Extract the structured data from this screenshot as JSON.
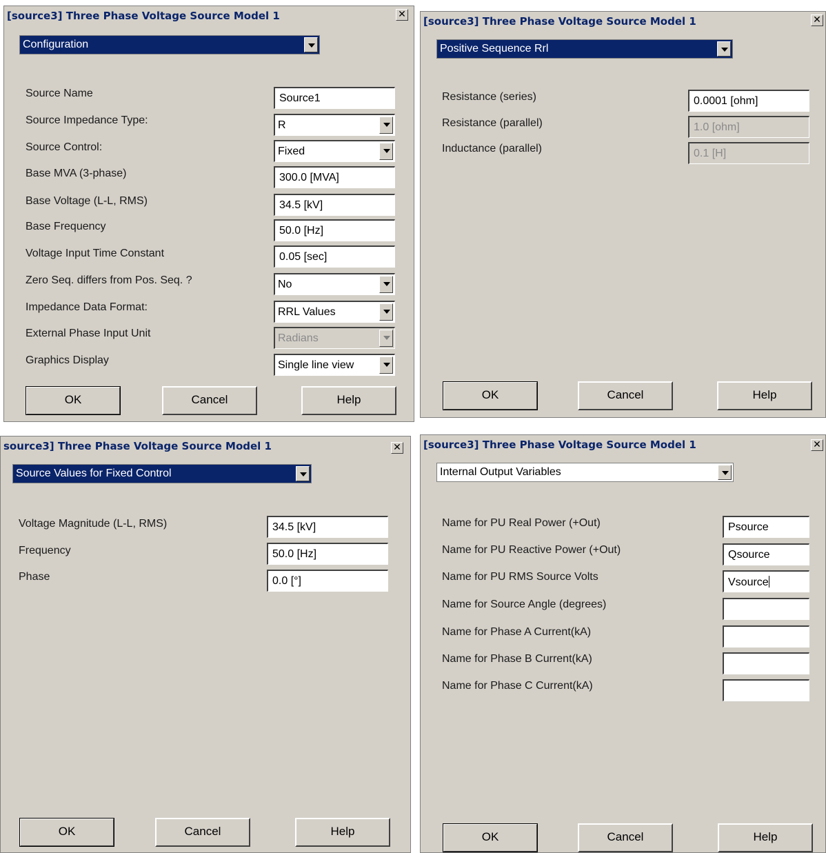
{
  "dialogs": [
    {
      "title": "[source3] Three Phase Voltage Source Model 1",
      "close": "✕",
      "category": "Configuration",
      "fields": [
        {
          "label": "Source Name",
          "value": "Source1",
          "kind": "text"
        },
        {
          "label": "Source Impedance Type:",
          "value": "R",
          "kind": "select"
        },
        {
          "label": "Source Control:",
          "value": "Fixed",
          "kind": "select"
        },
        {
          "label": "Base MVA (3-phase)",
          "value": "300.0 [MVA]",
          "kind": "text"
        },
        {
          "label": "Base Voltage (L-L, RMS)",
          "value": "34.5 [kV]",
          "kind": "text"
        },
        {
          "label": "Base Frequency",
          "value": "50.0 [Hz]",
          "kind": "text"
        },
        {
          "label": "Voltage Input Time Constant",
          "value": "0.05 [sec]",
          "kind": "text"
        },
        {
          "label": "Zero Seq. differs from Pos. Seq. ?",
          "value": "No",
          "kind": "select"
        },
        {
          "label": "Impedance Data Format:",
          "value": "RRL Values",
          "kind": "select"
        },
        {
          "label": "External Phase Input Unit",
          "value": "Radians",
          "kind": "select",
          "disabled": true
        },
        {
          "label": "Graphics Display",
          "value": "Single line view",
          "kind": "select"
        }
      ],
      "buttons": {
        "ok": "OK",
        "cancel": "Cancel",
        "help": "Help"
      }
    },
    {
      "title": "[source3] Three Phase Voltage Source Model 1",
      "close": "✕",
      "category": "Positive Sequence Rrl",
      "fields": [
        {
          "label": "Resistance (series)",
          "value": "0.0001 [ohm]",
          "kind": "text"
        },
        {
          "label": "Resistance (parallel)",
          "value": "1.0 [ohm]",
          "kind": "text",
          "disabled": true
        },
        {
          "label": "Inductance (parallel)",
          "value": "0.1 [H]",
          "kind": "text",
          "disabled": true
        }
      ],
      "buttons": {
        "ok": "OK",
        "cancel": "Cancel",
        "help": "Help"
      }
    },
    {
      "title": "source3] Three Phase Voltage Source Model 1",
      "close": "✕",
      "category": "Source Values for Fixed Control",
      "fields": [
        {
          "label": "Voltage Magnitude (L-L, RMS)",
          "value": "34.5 [kV]",
          "kind": "text"
        },
        {
          "label": "Frequency",
          "value": "50.0 [Hz]",
          "kind": "text"
        },
        {
          "label": "Phase",
          "value": "0.0 [°]",
          "kind": "text"
        }
      ],
      "buttons": {
        "ok": "OK",
        "cancel": "Cancel",
        "help": "Help"
      }
    },
    {
      "title": "[source3] Three Phase Voltage Source Model 1",
      "close": "✕",
      "category": "Internal Output Variables",
      "fields": [
        {
          "label": "Name for PU Real Power (+Out)",
          "value": "Psource",
          "kind": "text"
        },
        {
          "label": "Name for PU Reactive Power (+Out)",
          "value": "Qsource",
          "kind": "text"
        },
        {
          "label": "Name for PU RMS Source Volts",
          "value": "Vsource",
          "kind": "text"
        },
        {
          "label": "Name for Source Angle (degrees)",
          "value": "",
          "kind": "text"
        },
        {
          "label": "Name for Phase A Current(kA)",
          "value": "",
          "kind": "text"
        },
        {
          "label": "Name for Phase B Current(kA)",
          "value": "",
          "kind": "text"
        },
        {
          "label": "Name for Phase C Current(kA)",
          "value": "",
          "kind": "text"
        }
      ],
      "buttons": {
        "ok": "OK",
        "cancel": "Cancel",
        "help": "Help"
      }
    }
  ]
}
